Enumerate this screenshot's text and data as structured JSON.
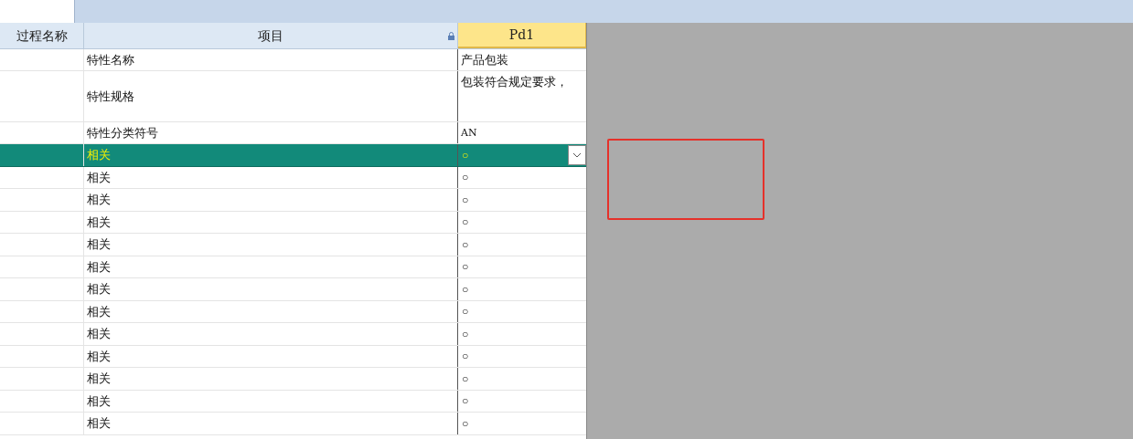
{
  "columns": [
    {
      "label": "过程名称",
      "locked": false,
      "kind": "plain"
    },
    {
      "label": "项目",
      "locked": true,
      "kind": "plain"
    },
    {
      "label": "Pd1",
      "locked": false,
      "kind": "highlight"
    }
  ],
  "header_rows": [
    {
      "item": "特性名称",
      "value": "产品包装",
      "kind": "normal"
    },
    {
      "item": "特性规格",
      "value": "包装符合规定要求，",
      "kind": "tall"
    },
    {
      "item": "特性分类符号",
      "value": "AN",
      "kind": "normal"
    }
  ],
  "rows": [
    {
      "item": "相关",
      "value": "○",
      "selected": true
    },
    {
      "item": "相关",
      "value": "○",
      "selected": false
    },
    {
      "item": "相关",
      "value": "○",
      "selected": false
    },
    {
      "item": "相关",
      "value": "○",
      "selected": false
    },
    {
      "item": "相关",
      "value": "○",
      "selected": false
    },
    {
      "item": "相关",
      "value": "○",
      "selected": false
    },
    {
      "item": "相关",
      "value": "○",
      "selected": false
    },
    {
      "item": "相关",
      "value": "○",
      "selected": false
    },
    {
      "item": "相关",
      "value": "○",
      "selected": false
    },
    {
      "item": "相关",
      "value": "○",
      "selected": false
    },
    {
      "item": "相关",
      "value": "○",
      "selected": false
    },
    {
      "item": "相关",
      "value": "○",
      "selected": false
    },
    {
      "item": "相关",
      "value": "○",
      "selected": false
    }
  ]
}
